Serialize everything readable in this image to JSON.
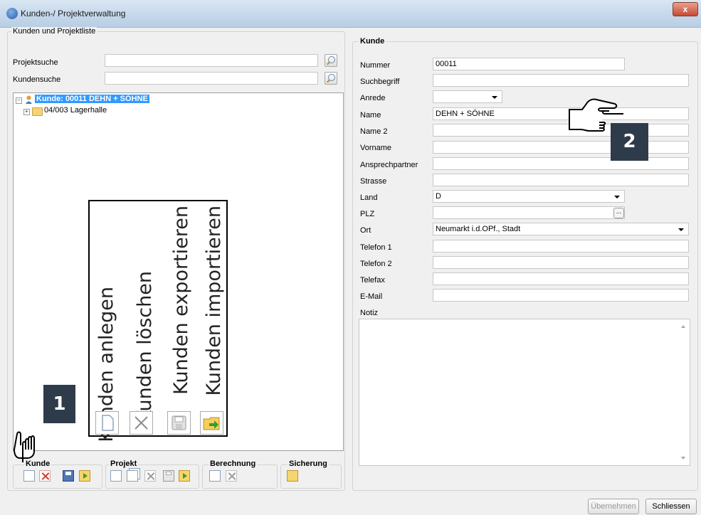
{
  "window": {
    "title": "Kunden-/ Projektverwaltung",
    "close_label": "x"
  },
  "list_panel": {
    "legend": "Kunden und Projektliste",
    "project_search_label": "Projektsuche",
    "customer_search_label": "Kundensuche",
    "tree": {
      "root_label": "Kunde: 00011 DEHN + SÖHNE",
      "child_label": "04/003 Lagerhalle",
      "root_expander": "−",
      "child_expander": "+"
    }
  },
  "toolbars": {
    "kunde_label": "Kunde",
    "projekt_label": "Projekt",
    "berechnung_label": "Berechnung",
    "sicherung_label": "Sicherung"
  },
  "callout": {
    "items": [
      "Kunden anlegen",
      "Kunden löschen",
      "Kunden exportieren",
      "Kunden importieren"
    ],
    "badge_1": "1",
    "badge_2": "2"
  },
  "customer_form": {
    "legend": "Kunde",
    "fields": {
      "nummer": {
        "label": "Nummer",
        "value": "00011"
      },
      "suchbegriff": {
        "label": "Suchbegriff",
        "value": ""
      },
      "anrede": {
        "label": "Anrede",
        "value": ""
      },
      "name": {
        "label": "Name",
        "value": "DEHN + SÖHNE"
      },
      "name2": {
        "label": "Name 2",
        "value": ""
      },
      "vorname": {
        "label": "Vorname",
        "value": ""
      },
      "ansprechpartner": {
        "label": "Ansprechpartner",
        "value": ""
      },
      "strasse": {
        "label": "Strasse",
        "value": ""
      },
      "land": {
        "label": "Land",
        "value": "D"
      },
      "plz": {
        "label": "PLZ",
        "value": ""
      },
      "ort": {
        "label": "Ort",
        "value": "Neumarkt i.d.OPf., Stadt"
      },
      "telefon1": {
        "label": "Telefon 1",
        "value": ""
      },
      "telefon2": {
        "label": "Telefon 2",
        "value": ""
      },
      "telefax": {
        "label": "Telefax",
        "value": ""
      },
      "email": {
        "label": "E-Mail",
        "value": ""
      },
      "notiz": {
        "label": "Notiz",
        "value": ""
      }
    },
    "plz_button": "..."
  },
  "footer": {
    "apply_label": "Übernehmen",
    "close_label": "Schliessen"
  }
}
